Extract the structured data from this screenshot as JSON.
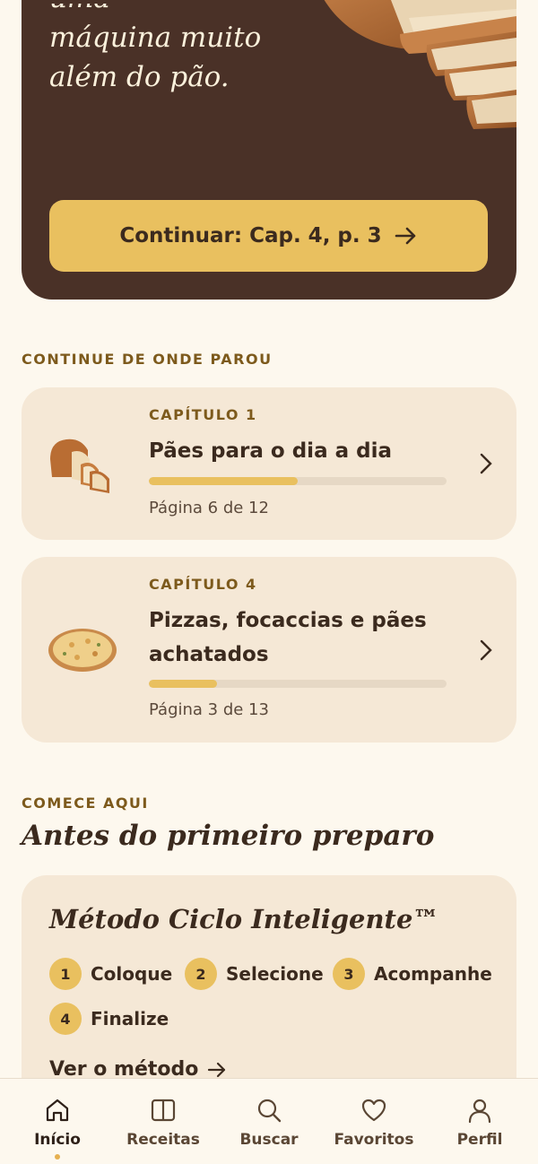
{
  "hero": {
    "title_partial": "uma",
    "title_line1": "máquina muito",
    "title_line2": "além do pão.",
    "continue_label": "Continuar: Cap. 4, p. 3"
  },
  "continue_section": {
    "eyebrow": "CONTINUE DE ONDE PAROU",
    "chapters": [
      {
        "number": "CAPÍTULO 1",
        "name": "Pães para o dia a dia",
        "progress": 0.5,
        "page_text": "Página 6 de 12",
        "thumb_icon": "bread-loaf-icon"
      },
      {
        "number": "CAPÍTULO 4",
        "name": "Pizzas, focaccias e pães achatados",
        "progress": 0.23,
        "page_text": "Página 3 de 13",
        "thumb_icon": "pizza-icon"
      }
    ]
  },
  "start_section": {
    "eyebrow": "COMECE AQUI",
    "title": "Antes do primeiro preparo",
    "method": {
      "title": "Método Ciclo Inteligente™",
      "steps": [
        {
          "num": "1",
          "label": "Coloque"
        },
        {
          "num": "2",
          "label": "Selecione"
        },
        {
          "num": "3",
          "label": "Acompanhe"
        },
        {
          "num": "4",
          "label": "Finalize"
        }
      ],
      "link_label": "Ver o método"
    }
  },
  "nav": {
    "items": [
      {
        "label": "Início",
        "icon": "home-icon",
        "active": true
      },
      {
        "label": "Receitas",
        "icon": "book-icon"
      },
      {
        "label": "Buscar",
        "icon": "search-icon"
      },
      {
        "label": "Favoritos",
        "icon": "heart-icon"
      },
      {
        "label": "Perfil",
        "icon": "user-icon"
      }
    ]
  },
  "colors": {
    "background": "#fdf8ee",
    "hero": "#4a3127",
    "accent": "#e9c05f",
    "card": "#f5e8d6",
    "eyebrow": "#7d5a1c"
  }
}
